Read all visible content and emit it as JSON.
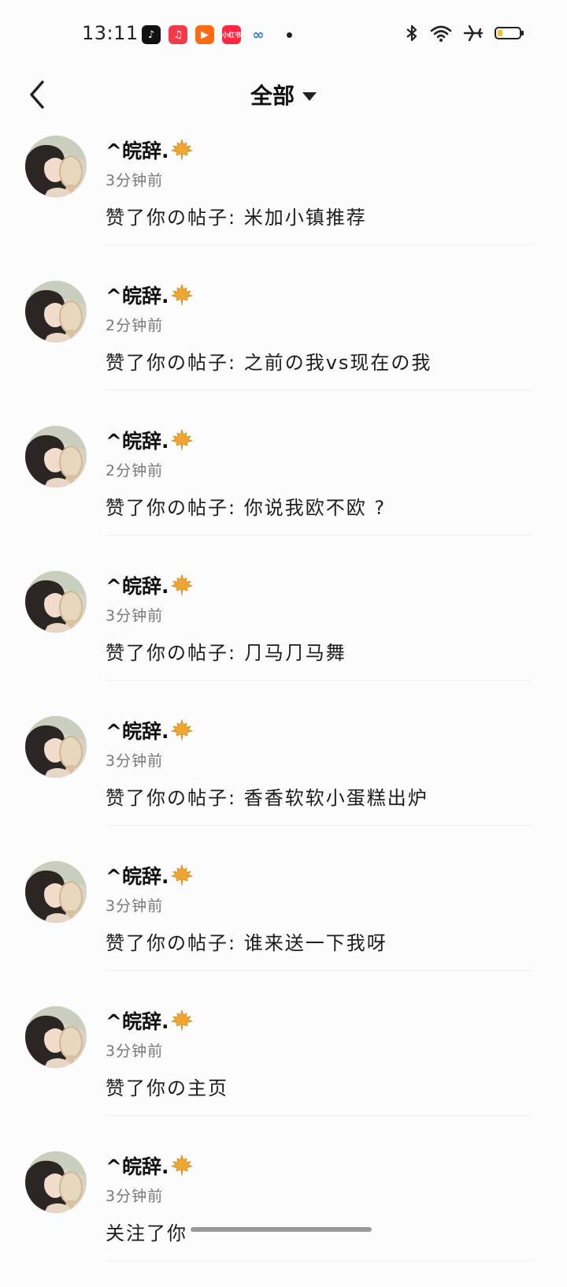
{
  "status_bar": {
    "time": "13:11",
    "apps": [
      "tiktok-icon",
      "music-icon",
      "kuaishou-icon",
      "xiaohongshu-icon",
      "cloud-icon"
    ],
    "red_app_label": "小红书",
    "battery_color": "#f2c230"
  },
  "header": {
    "title": "全部"
  },
  "notifications": [
    {
      "name": "^皖辞.",
      "time": "3分钟前",
      "message": "赞了你の帖子: 米加小镇推荐"
    },
    {
      "name": "^皖辞.",
      "time": "2分钟前",
      "message": "赞了你の帖子: 之前の我vs现在の我"
    },
    {
      "name": "^皖辞.",
      "time": "2分钟前",
      "message": "赞了你の帖子: 你说我欧不欧 ?"
    },
    {
      "name": "^皖辞.",
      "time": "3分钟前",
      "message": "赞了你の帖子: ⺆马⺆马舞"
    },
    {
      "name": "^皖辞.",
      "time": "3分钟前",
      "message": "赞了你の帖子: 香香软软小蛋糕出炉"
    },
    {
      "name": "^皖辞.",
      "time": "3分钟前",
      "message": "赞了你の帖子: 谁来送一下我呀"
    },
    {
      "name": "^皖辞.",
      "time": "3分钟前",
      "message": "赞了你の主页"
    },
    {
      "name": "^皖辞.",
      "time": "3分钟前",
      "message": "关注了你"
    }
  ]
}
